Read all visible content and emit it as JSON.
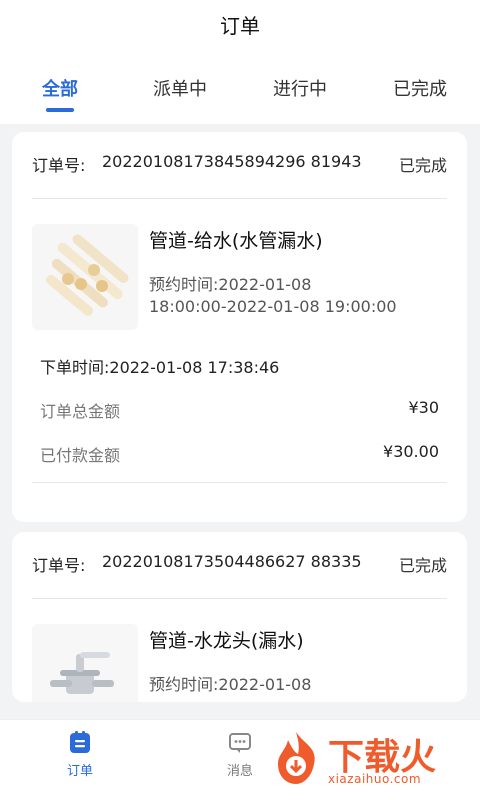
{
  "header": {
    "title": "订单"
  },
  "tabs": [
    {
      "label": "全部",
      "active": true
    },
    {
      "label": "派单中",
      "active": false
    },
    {
      "label": "进行中",
      "active": false
    },
    {
      "label": "已完成",
      "active": false
    }
  ],
  "orders": [
    {
      "order_label": "订单号:",
      "order_no": "20220108173845894296 81943",
      "status": "已完成",
      "product_name": "管道-给水(水管漏水)",
      "appt_line1": "预约时间:2022-01-08",
      "appt_line2": "18:00:00-2022-01-08 19:00:00",
      "created_at": "下单时间:2022-01-08 17:38:46",
      "total_label": "订单总金额",
      "total_value": "¥30",
      "paid_label": "已付款金额",
      "paid_value": "¥30.00"
    },
    {
      "order_label": "订单号:",
      "order_no": "20220108173504486627 88335",
      "status": "已完成",
      "product_name": "管道-水龙头(漏水)",
      "appt_line1": "预约时间:2022-01-08"
    }
  ],
  "bottom_nav": [
    {
      "label": "订单",
      "icon": "order-icon",
      "active": true
    },
    {
      "label": "消息",
      "icon": "message-icon",
      "active": false
    }
  ],
  "watermark": {
    "text": "下载火",
    "sub": "xiazaihuo.com",
    "color": "#ef5b2a"
  },
  "colors": {
    "accent": "#2a6bd9"
  }
}
